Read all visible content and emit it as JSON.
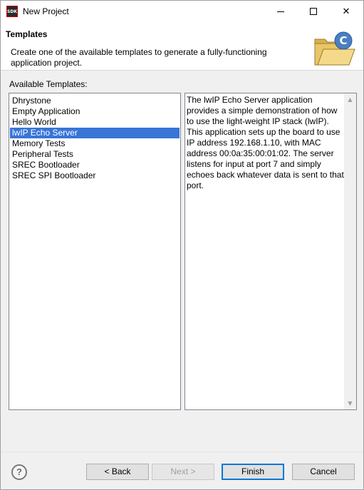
{
  "window": {
    "title": "New Project",
    "app_icon_text": "SDK",
    "close_glyph": "✕"
  },
  "banner": {
    "title": "Templates",
    "description": "Create one of the available templates to generate a fully-functioning application project.",
    "graphic_letter": "C"
  },
  "templates": {
    "label": "Available Templates:",
    "items": [
      {
        "label": "Dhrystone",
        "selected": false
      },
      {
        "label": "Empty Application",
        "selected": false
      },
      {
        "label": "Hello World",
        "selected": false
      },
      {
        "label": "lwIP Echo Server",
        "selected": true
      },
      {
        "label": "Memory Tests",
        "selected": false
      },
      {
        "label": "Peripheral Tests",
        "selected": false
      },
      {
        "label": "SREC Bootloader",
        "selected": false
      },
      {
        "label": "SREC SPI Bootloader",
        "selected": false
      }
    ],
    "description": "The lwIP Echo Server application provides a simple demonstration of how to use the light-weight IP stack (lwIP). This application sets up the board to use IP address 192.168.1.10, with MAC address 00:0a:35:00:01:02. The server listens for input at port 7 and simply echoes back whatever data is sent to that port."
  },
  "footer": {
    "help_glyph": "?",
    "back_label": "< Back",
    "next_label": "Next >",
    "finish_label": "Finish",
    "cancel_label": "Cancel"
  },
  "colors": {
    "selection": "#3875d7",
    "default_button_border": "#0078d7"
  }
}
